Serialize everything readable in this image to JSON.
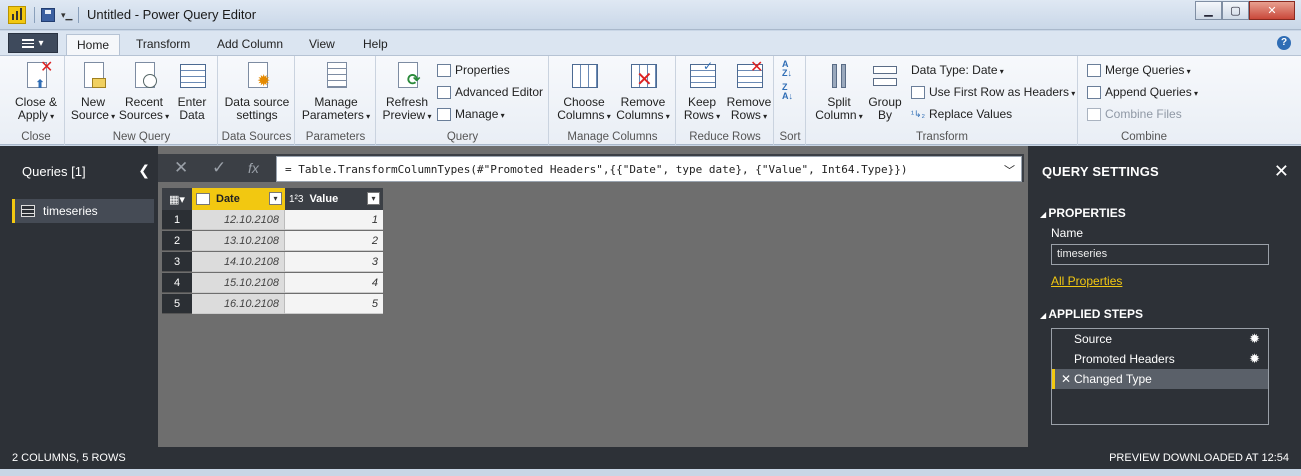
{
  "window": {
    "title": "Untitled - Power Query Editor"
  },
  "ribbon_tabs": [
    "Home",
    "Transform",
    "Add Column",
    "View",
    "Help"
  ],
  "ribbon": {
    "close": {
      "group": "Close",
      "close_apply": [
        "Close &",
        "Apply"
      ]
    },
    "new_query": {
      "group": "New Query",
      "new_source": [
        "New",
        "Source"
      ],
      "recent_sources": [
        "Recent",
        "Sources"
      ],
      "enter_data": [
        "Enter",
        "Data"
      ]
    },
    "data_sources": {
      "group": "Data Sources",
      "settings": [
        "Data source",
        "settings"
      ]
    },
    "parameters": {
      "group": "Parameters",
      "manage": [
        "Manage",
        "Parameters"
      ]
    },
    "query": {
      "group": "Query",
      "refresh": [
        "Refresh",
        "Preview"
      ],
      "properties": "Properties",
      "advanced_editor": "Advanced Editor",
      "manage": "Manage"
    },
    "manage_columns": {
      "group": "Manage Columns",
      "choose": [
        "Choose",
        "Columns"
      ],
      "remove": [
        "Remove",
        "Columns"
      ]
    },
    "reduce_rows": {
      "group": "Reduce Rows",
      "keep": [
        "Keep",
        "Rows"
      ],
      "remove": [
        "Remove",
        "Rows"
      ]
    },
    "sort": {
      "group": "Sort"
    },
    "transform": {
      "group": "Transform",
      "split": [
        "Split",
        "Column"
      ],
      "group_by": [
        "Group",
        "By"
      ],
      "data_type": "Data Type: Date",
      "first_row": "Use First Row as Headers",
      "replace": "Replace Values"
    },
    "combine": {
      "group": "Combine",
      "merge": "Merge Queries",
      "append": "Append Queries",
      "combine_files": "Combine Files"
    }
  },
  "queries_panel": {
    "title": "Queries [1]",
    "items": [
      "timeseries"
    ]
  },
  "formula": {
    "text": "= Table.TransformColumnTypes(#\"Promoted Headers\",{{\"Date\", type date}, {\"Value\", Int64.Type}})"
  },
  "table": {
    "columns": [
      {
        "name": "Date",
        "type_icon": "calendar-icon"
      },
      {
        "name": "Value",
        "type_icon": "1²3"
      }
    ],
    "rows": [
      {
        "n": "1",
        "date": "12.10.2108",
        "value": "1"
      },
      {
        "n": "2",
        "date": "13.10.2108",
        "value": "2"
      },
      {
        "n": "3",
        "date": "14.10.2108",
        "value": "3"
      },
      {
        "n": "4",
        "date": "15.10.2108",
        "value": "4"
      },
      {
        "n": "5",
        "date": "16.10.2108",
        "value": "5"
      }
    ]
  },
  "settings": {
    "title": "QUERY SETTINGS",
    "properties_header": "PROPERTIES",
    "name_label": "Name",
    "name_value": "timeseries",
    "all_properties": "All Properties",
    "steps_header": "APPLIED STEPS",
    "steps": [
      "Source",
      "Promoted Headers",
      "Changed Type"
    ]
  },
  "status": {
    "left": "2 COLUMNS, 5 ROWS",
    "right": "PREVIEW DOWNLOADED AT 12:54"
  },
  "colors": {
    "accent": "#f2c811",
    "dark_panel": "#2d3137",
    "canvas": "#6e6e6e"
  }
}
